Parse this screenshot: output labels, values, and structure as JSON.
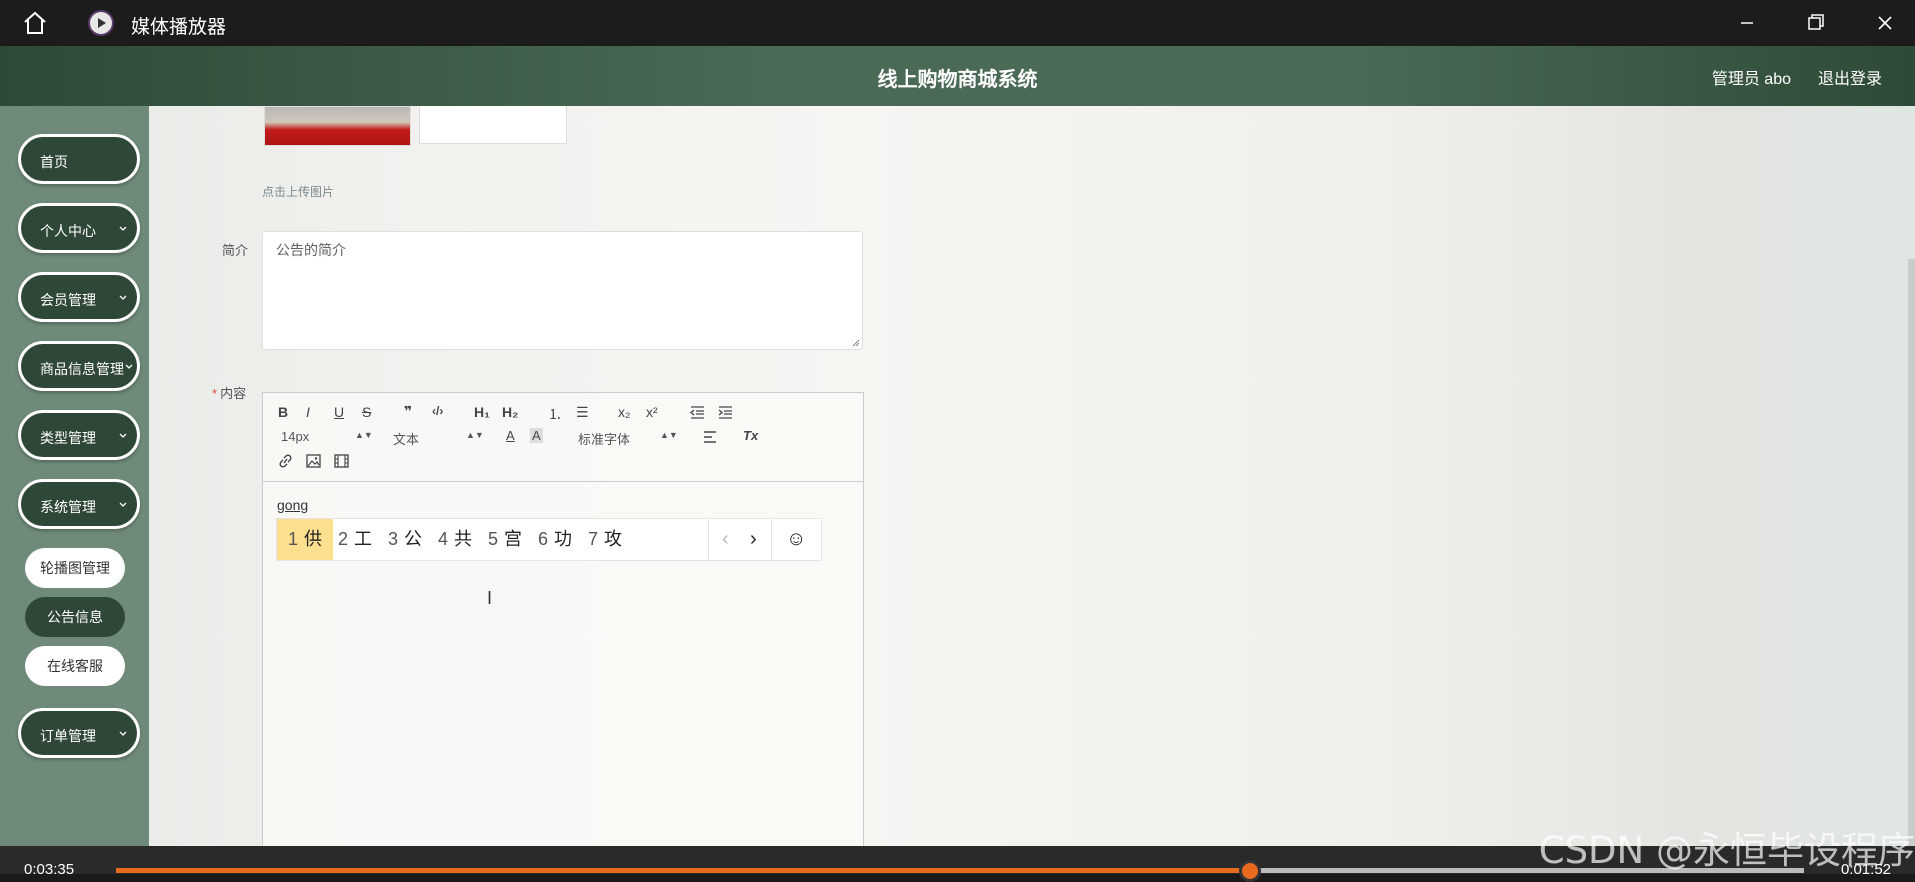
{
  "player": {
    "title": "媒体播放器",
    "time_current": "0:03:35",
    "time_remaining": "0:01:52",
    "progress": 0.672,
    "watermark": "CSDN @永恒毕设程序"
  },
  "header": {
    "title": "线上购物商城系统",
    "admin": "管理员 abo",
    "logout": "退出登录"
  },
  "sidebar": {
    "items": [
      {
        "label": "首页"
      },
      {
        "label": "个人中心"
      },
      {
        "label": "会员管理"
      },
      {
        "label": "商品信息管理"
      },
      {
        "label": "类型管理"
      },
      {
        "label": "系统管理"
      },
      {
        "label": "订单管理"
      }
    ],
    "subitems": [
      {
        "label": "轮播图管理"
      },
      {
        "label": "公告信息"
      },
      {
        "label": "在线客服"
      }
    ]
  },
  "form": {
    "upload_tip": "点击上传图片",
    "intro_label": "简介",
    "intro_value": "公告的简介",
    "content_label": "内容",
    "required_mark": "*"
  },
  "editor": {
    "toolbar": {
      "bold": "B",
      "italic": "I",
      "underline": "U",
      "strike": "S",
      "quote": "❞",
      "code": "‹/›",
      "h1": "H₁",
      "h2": "H₂",
      "ordered": "⒈",
      "bullet": "☰",
      "sub": "x₂",
      "sup": "x²",
      "size": "14px",
      "header": "文本",
      "font": "标准字体",
      "clean": "Tx"
    },
    "body_text": "gong"
  },
  "ime": {
    "candidates": [
      {
        "n": "1",
        "ch": "供"
      },
      {
        "n": "2",
        "ch": "工"
      },
      {
        "n": "3",
        "ch": "公"
      },
      {
        "n": "4",
        "ch": "共"
      },
      {
        "n": "5",
        "ch": "宫"
      },
      {
        "n": "6",
        "ch": "功"
      },
      {
        "n": "7",
        "ch": "攻"
      }
    ],
    "prev": "‹",
    "next": "›",
    "emoji": "☺",
    "highlight_color": "#fde08f"
  },
  "colors": {
    "header_bg": "#4a6a55",
    "menu_bg": "#2f4737",
    "progress": "#e86a1f"
  }
}
